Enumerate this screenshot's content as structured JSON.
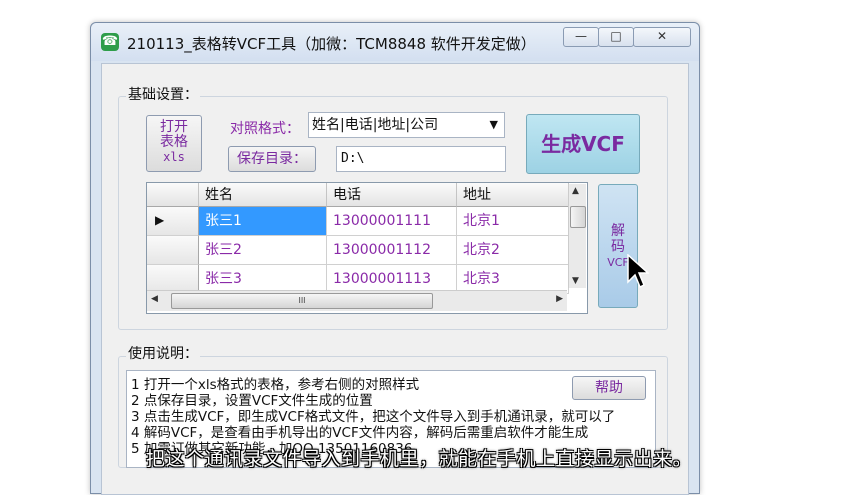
{
  "window": {
    "title": "210113_表格转VCF工具（加微：TCM8848 软件开发定做）",
    "controls": {
      "minimize": "—",
      "maximize": "□",
      "close": "✕"
    }
  },
  "settings": {
    "group_label": "基础设置：",
    "open_button": {
      "line1": "打开",
      "line2": "表格",
      "line3": "xls"
    },
    "mapping_label": "对照格式：",
    "mapping_selected": "姓名|电话|地址|公司",
    "save_dir_button": "保存目录：",
    "save_dir_value": "D:\\",
    "generate_button": "生成VCF",
    "decode_button": {
      "line1": "解",
      "line2": "码",
      "line3": "VCF"
    }
  },
  "table": {
    "columns": [
      "姓名",
      "电话",
      "地址"
    ],
    "rows": [
      {
        "name": "张三1",
        "phone": "13000001111",
        "addr": "北京1"
      },
      {
        "name": "张三2",
        "phone": "13000001112",
        "addr": "北京2"
      },
      {
        "name": "张三3",
        "phone": "13000001113",
        "addr": "北京3"
      }
    ],
    "scroll_thumb_glyph": "III"
  },
  "instructions": {
    "group_label": "使用说明：",
    "help_button": "帮助",
    "lines": [
      "1 打开一个xls格式的表格，参考右侧的对照样式",
      "2 点保存目录，设置VCF文件生成的位置",
      "3 点击生成VCF，即生成VCF格式文件，把这个文件导入到手机通讯录，就可以了",
      "4 解码VCF，是查看由手机导出的VCF文件内容，解码后需重启软件才能生成",
      "5 加需订做其它新功能，加QQ 13501160836"
    ]
  },
  "subtitle": "把这个通讯录文件导入到手机里，就能在手机上直接显示出来。",
  "colors": {
    "accent_purple": "#8a2aa8",
    "selected_cell": "#3399ff",
    "generate_bg": "#a9d8e8"
  }
}
